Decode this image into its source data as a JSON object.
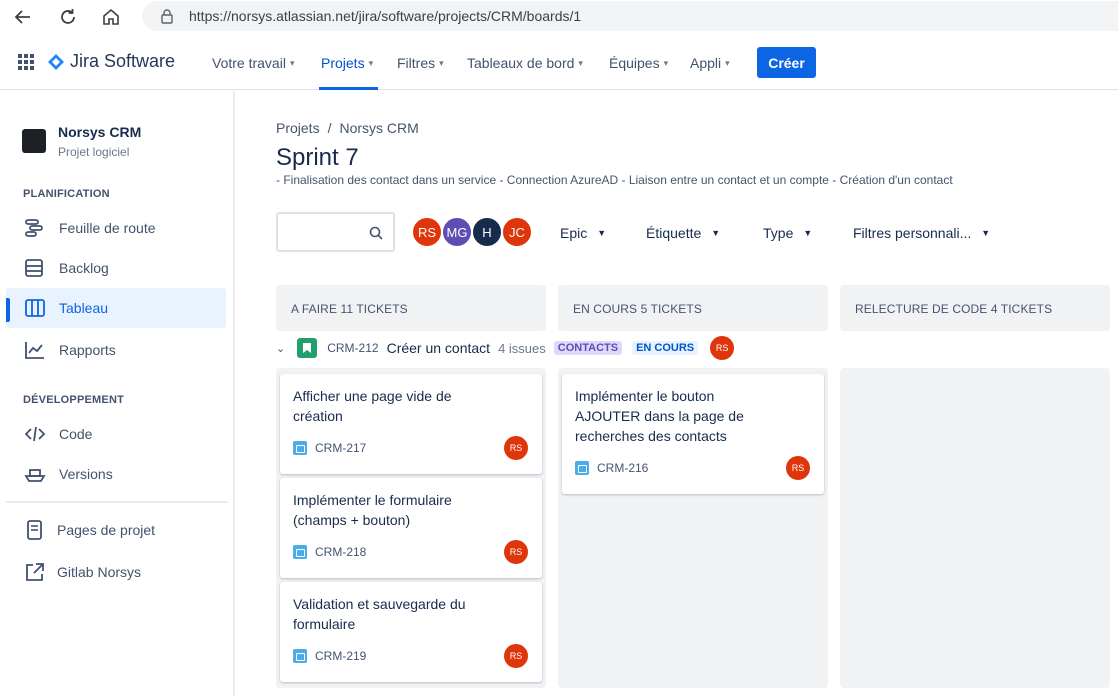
{
  "browser": {
    "url": "https://norsys.atlassian.net/jira/software/projects/CRM/boards/1"
  },
  "topnav": {
    "product": "Jira Software",
    "items": [
      {
        "label": "Votre travail"
      },
      {
        "label": "Projets"
      },
      {
        "label": "Filtres"
      },
      {
        "label": "Tableaux de bord"
      },
      {
        "label": "Équipes"
      },
      {
        "label": "Appli"
      }
    ],
    "create_label": "Créer",
    "accent": "#0c66e4"
  },
  "sidebar": {
    "project_name": "Norsys CRM",
    "project_type": "Projet logiciel",
    "planning_header": "PLANIFICATION",
    "planning_items": [
      {
        "label": "Feuille de route",
        "icon": "roadmap-icon"
      },
      {
        "label": "Backlog",
        "icon": "backlog-icon"
      },
      {
        "label": "Tableau",
        "icon": "board-icon"
      },
      {
        "label": "Rapports",
        "icon": "reports-icon"
      }
    ],
    "dev_header": "DÉVELOPPEMENT",
    "dev_items": [
      {
        "label": "Code",
        "icon": "code-icon"
      },
      {
        "label": "Versions",
        "icon": "versions-icon"
      }
    ],
    "extra_items": [
      {
        "label": "Pages de projet",
        "icon": "page-icon"
      },
      {
        "label": "Gitlab Norsys",
        "icon": "external-link-icon"
      }
    ]
  },
  "breadcrumb": {
    "root": "Projets",
    "sep": "/",
    "project": "Norsys CRM"
  },
  "title": "Sprint 7",
  "sprint_goal": "- Finalisation des contact dans un service - Connection AzureAD - Liaison entre un contact et un compte - Création d'un contact",
  "filters": {
    "avatars": [
      {
        "initials": "RS",
        "color": "#de350b"
      },
      {
        "initials": "MG",
        "color": "#5e4db2"
      },
      {
        "initials": "H",
        "color": "#172b4d"
      },
      {
        "initials": "JC",
        "color": "#de350b"
      }
    ],
    "epic": "Epic",
    "label": "Étiquette",
    "type": "Type",
    "custom": "Filtres personnali..."
  },
  "columns": [
    {
      "title": "A FAIRE 11 TICKETS"
    },
    {
      "title": "EN COURS 5 TICKETS"
    },
    {
      "title": "RELECTURE DE CODE 4 TICKETS"
    }
  ],
  "swimlane": {
    "key": "CRM-212",
    "summary": "Créer un contact",
    "count": "4 issues",
    "epic_lozenge": "CONTACTS",
    "status_lozenge": "EN COURS",
    "assignee": "RS"
  },
  "cards": {
    "todo": [
      {
        "title_line1": "Afficher une page vide de",
        "title_line2": "création",
        "key": "CRM-217",
        "assignee": "RS"
      },
      {
        "title_line1": "Implémenter le formulaire",
        "title_line2": "(champs + bouton)",
        "key": "CRM-218",
        "assignee": "RS"
      },
      {
        "title_line1": "Validation et sauvegarde du",
        "title_line2": "formulaire",
        "key": "CRM-219",
        "assignee": "RS"
      }
    ],
    "in_progress": [
      {
        "title_line1": "Implémenter le bouton",
        "title_line2": "AJOUTER dans la page de",
        "title_line3": "recherches des contacts",
        "key": "CRM-216",
        "assignee": "RS"
      }
    ]
  }
}
